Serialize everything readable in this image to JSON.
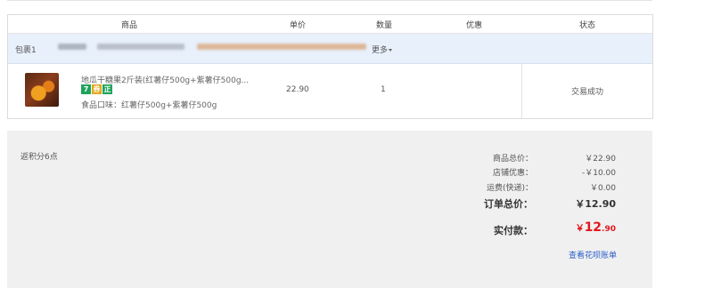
{
  "header": {
    "product": "商品",
    "unit_price": "单价",
    "quantity": "数量",
    "discount": "优惠",
    "status": "状态"
  },
  "package": {
    "label": "包裹1",
    "more": "更多"
  },
  "item": {
    "title": "地瓜干糖果2斤装(红薯仔500g+紫薯仔500g...",
    "badges": [
      "7",
      "券",
      "正"
    ],
    "flavor_label": "食品口味：",
    "flavor_value": "红薯仔500g+紫薯仔500g",
    "price": "22.90",
    "quantity": "1",
    "status": "交易成功"
  },
  "summary": {
    "points": "返积分6点",
    "goods_total_label": "商品总价：",
    "goods_total_value": "￥22.90",
    "shop_discount_label": "店铺优惠：",
    "shop_discount_value": "-￥10.00",
    "shipping_label": "运费(快递)：",
    "shipping_value": "￥0.00",
    "order_total_label": "订单总价：",
    "order_total_value": "￥12.90",
    "paid_label": "实付款：",
    "paid_currency": "￥",
    "paid_integer": "12",
    "paid_decimal": ".90",
    "bill_link": "查看花呗账单"
  },
  "colors": {
    "package_bg": "#e8f0fb",
    "summary_bg": "#f0f0f0",
    "paid_red": "#e4151d",
    "link_blue": "#2b5ec9",
    "badge_green": "#1ea35a",
    "badge_orange": "#e3a51a"
  }
}
